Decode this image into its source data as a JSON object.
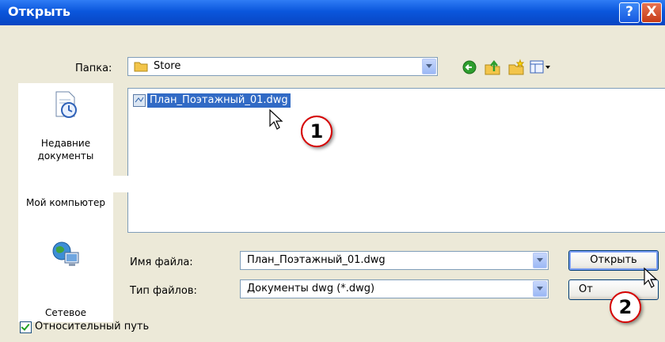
{
  "window": {
    "title": "Открыть",
    "help_glyph": "?",
    "close_glyph": "X"
  },
  "folder": {
    "label": "Папка:",
    "value": "Store"
  },
  "toolbar": {
    "icons": [
      "back-icon",
      "up-folder-icon",
      "new-folder-icon",
      "view-menu-icon"
    ],
    "colors": {
      "back": "#2e9e2e",
      "folder": "#f3c54a"
    }
  },
  "places": [
    {
      "label": "Недавние документы",
      "icon": "recent-documents-icon"
    },
    {
      "label": "Мой компьютер",
      "icon": "my-computer-icon"
    },
    {
      "label": "Сетевое",
      "icon": "network-icon"
    }
  ],
  "files": [
    {
      "name": "План_Поэтажный_01.dwg",
      "selected": true
    }
  ],
  "filename": {
    "label": "Имя файла:",
    "value": "План_Поэтажный_01.dwg"
  },
  "filetype": {
    "label": "Тип файлов:",
    "value": "Документы dwg (*.dwg)"
  },
  "buttons": {
    "open": "Открыть",
    "cancel": "От"
  },
  "checkbox": {
    "label": "Относительный путь",
    "checked": true
  },
  "callouts": [
    "1",
    "2"
  ]
}
